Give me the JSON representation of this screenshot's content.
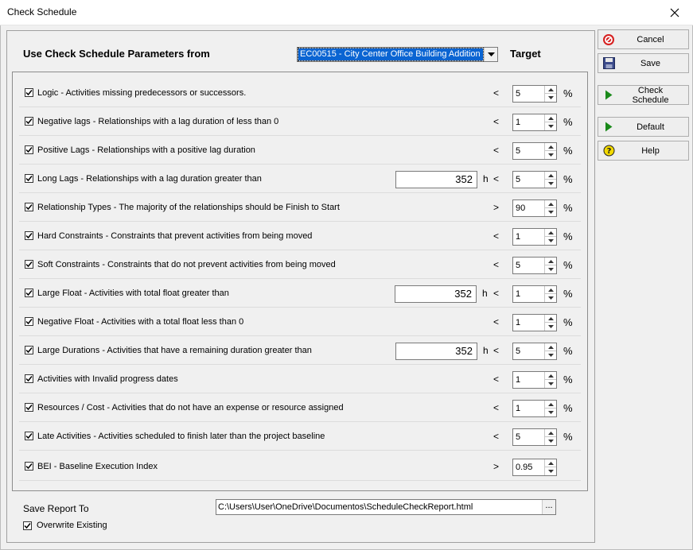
{
  "window": {
    "title": "Check Schedule"
  },
  "header": {
    "label": "Use Check Schedule Parameters from",
    "project": "EC00515 - City Center Office Building Addition",
    "target_label": "Target"
  },
  "rows": [
    {
      "label": "Logic - Activities missing predecessors or successors.",
      "op": "<",
      "target": "5",
      "unit": "%"
    },
    {
      "label": "Negative lags - Relationships with a lag duration of less than 0",
      "op": "<",
      "target": "1",
      "unit": "%"
    },
    {
      "label": "Positive Lags - Relationships with a positive lag duration",
      "op": "<",
      "target": "5",
      "unit": "%"
    },
    {
      "label": "Long Lags - Relationships with a lag duration greater than",
      "value": "352",
      "value_unit": "h",
      "op": "<",
      "target": "5",
      "unit": "%"
    },
    {
      "label": "Relationship Types - The majority of the relationships should be Finish to Start",
      "op": ">",
      "target": "90",
      "unit": "%"
    },
    {
      "label": "Hard Constraints - Constraints that prevent activities from being moved",
      "op": "<",
      "target": "1",
      "unit": "%"
    },
    {
      "label": "Soft Constraints - Constraints that do not prevent activities from being moved",
      "op": "<",
      "target": "5",
      "unit": "%"
    },
    {
      "label": "Large Float - Activities with total float greater than",
      "value": "352",
      "value_unit": "h",
      "op": "<",
      "target": "1",
      "unit": "%"
    },
    {
      "label": "Negative Float - Activities with a total float less than 0",
      "op": "<",
      "target": "1",
      "unit": "%"
    },
    {
      "label": "Large Durations - Activities that have a remaining duration greater than",
      "value": "352",
      "value_unit": "h",
      "op": "<",
      "target": "5",
      "unit": "%"
    },
    {
      "label": "Activities with Invalid progress dates",
      "op": "<",
      "target": "1",
      "unit": "%"
    },
    {
      "label": "Resources / Cost - Activities that do not have an expense or resource assigned",
      "op": "<",
      "target": "1",
      "unit": "%"
    },
    {
      "label": "Late Activities - Activities scheduled to finish later than the project baseline",
      "op": "<",
      "target": "5",
      "unit": "%"
    },
    {
      "label": "BEI - Baseline Execution Index",
      "op": ">",
      "target": "0.95",
      "unit": ""
    }
  ],
  "report": {
    "label": "Save Report To",
    "path": "C:\\Users\\User\\OneDrive\\Documentos\\ScheduleCheckReport.html",
    "browse": "...",
    "overwrite_label": "Overwrite Existing"
  },
  "buttons": {
    "cancel": "Cancel",
    "save": "Save",
    "check": "Check Schedule",
    "default": "Default",
    "help": "Help"
  },
  "colors": {
    "selection": "#0a64d2",
    "run_green": "#1a8a1a",
    "cancel_red": "#d62020",
    "help_yellow": "#f2d900"
  }
}
